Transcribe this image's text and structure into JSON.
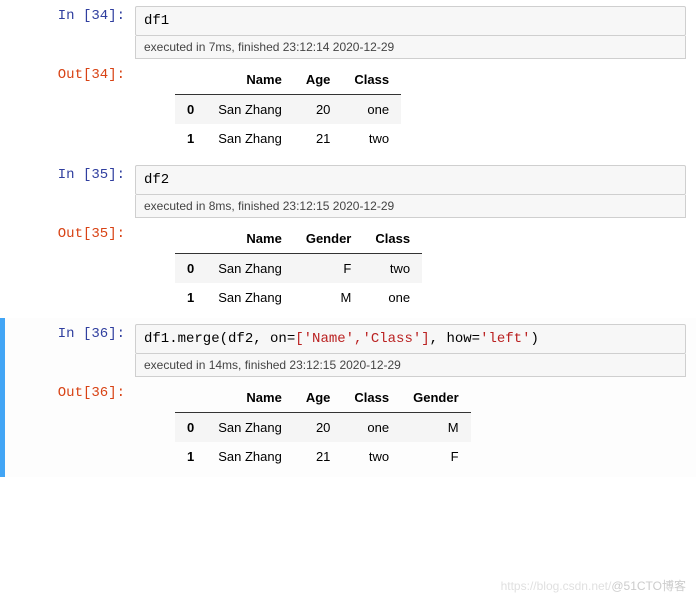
{
  "cells": [
    {
      "in_label": "In [34]:",
      "out_label": "Out[34]:",
      "code_html": "df1",
      "exec": "executed in 7ms, finished 23:12:14 2020-12-29",
      "table": {
        "headers": [
          "",
          "Name",
          "Age",
          "Class"
        ],
        "rows": [
          [
            "0",
            "San Zhang",
            "20",
            "one"
          ],
          [
            "1",
            "San Zhang",
            "21",
            "two"
          ]
        ]
      }
    },
    {
      "in_label": "In [35]:",
      "out_label": "Out[35]:",
      "code_html": "df2",
      "exec": "executed in 8ms, finished 23:12:15 2020-12-29",
      "table": {
        "headers": [
          "",
          "Name",
          "Gender",
          "Class"
        ],
        "rows": [
          [
            "0",
            "San Zhang",
            "F",
            "two"
          ],
          [
            "1",
            "San Zhang",
            "M",
            "one"
          ]
        ]
      }
    },
    {
      "in_label": "In [36]:",
      "out_label": "Out[36]:",
      "code_html": "df1.merge(df2, on=<span class=\"code-str\">['Name','Class']</span>, how=<span class=\"code-str\">'left'</span>)",
      "exec": "executed in 14ms, finished 23:12:15 2020-12-29",
      "table": {
        "headers": [
          "",
          "Name",
          "Age",
          "Class",
          "Gender"
        ],
        "rows": [
          [
            "0",
            "San Zhang",
            "20",
            "one",
            "M"
          ],
          [
            "1",
            "San Zhang",
            "21",
            "two",
            "F"
          ]
        ]
      }
    }
  ],
  "watermark": {
    "light": "https://blog.csdn.net/",
    "dark": "@51CTO博客"
  }
}
